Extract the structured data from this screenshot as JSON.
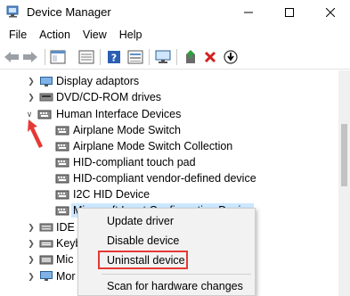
{
  "window": {
    "title": "Device Manager",
    "controls": {
      "minimize": "—",
      "maximize": "☐",
      "close": "✕"
    }
  },
  "menubar": {
    "items": [
      {
        "label": "File"
      },
      {
        "label": "Action"
      },
      {
        "label": "View"
      },
      {
        "label": "Help"
      }
    ]
  },
  "toolbar": {
    "buttons": [
      {
        "icon": "back-arrow-icon"
      },
      {
        "icon": "forward-arrow-icon"
      },
      {
        "icon": "properties-panel-icon"
      },
      {
        "icon": "show-hidden-icon"
      },
      {
        "icon": "help-icon"
      },
      {
        "icon": "list-view-icon"
      },
      {
        "icon": "monitor-icon"
      },
      {
        "icon": "update-driver-icon"
      },
      {
        "icon": "uninstall-x-icon"
      },
      {
        "icon": "download-circle-icon"
      }
    ]
  },
  "tree": {
    "rows": [
      {
        "label": "Display adaptors",
        "expanded": false,
        "indent": 0
      },
      {
        "label": "DVD/CD-ROM drives",
        "expanded": false,
        "indent": 0
      },
      {
        "label": "Human Interface Devices",
        "expanded": true,
        "indent": 0
      },
      {
        "label": "Airplane Mode Switch",
        "indent": 1
      },
      {
        "label": "Airplane Mode Switch Collection",
        "indent": 1
      },
      {
        "label": "HID-compliant touch pad",
        "indent": 1
      },
      {
        "label": "HID-compliant vendor-defined device",
        "indent": 1
      },
      {
        "label": "I2C HID Device",
        "indent": 1
      },
      {
        "label": "Microsoft Input Configuration Device",
        "indent": 1,
        "selected": true
      },
      {
        "label": "IDE A",
        "expanded": false,
        "indent": 0
      },
      {
        "label": "Keyb",
        "expanded": false,
        "indent": 0
      },
      {
        "label": "Mic",
        "expanded": false,
        "indent": 0
      },
      {
        "label": "Mor",
        "expanded": false,
        "indent": 0
      }
    ]
  },
  "context_menu": {
    "items": [
      {
        "label": "Update driver"
      },
      {
        "label": "Disable device"
      },
      {
        "label": "Uninstall device",
        "highlighted": true
      },
      {
        "label": "Scan for hardware changes"
      }
    ]
  },
  "colors": {
    "selection": "#cce8ff",
    "highlight_border": "#e53935",
    "annotation_arrow": "#e53935"
  }
}
